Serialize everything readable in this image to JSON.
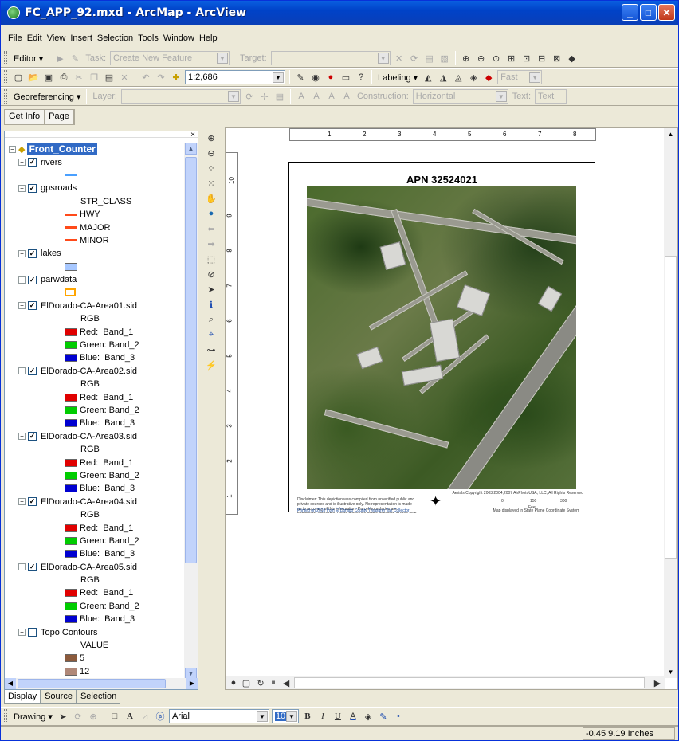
{
  "window": {
    "title": "FC_APP_92.mxd - ArcMap - ArcView"
  },
  "menu": [
    "File",
    "Edit",
    "View",
    "Insert",
    "Selection",
    "Tools",
    "Window",
    "Help"
  ],
  "editor_toolbar": {
    "editor": "Editor ▾",
    "task_label": "Task:",
    "task_value": "Create New Feature",
    "target_label": "Target:"
  },
  "standard_toolbar": {
    "scale": "1:2,686",
    "labeling": "Labeling ▾",
    "fast": "Fast"
  },
  "georef_toolbar": {
    "georeferencing": "Georeferencing ▾",
    "layer_label": "Layer:",
    "construction_label": "Construction:",
    "construction_value": "Horizontal",
    "text_label": "Text:",
    "text_value": "Text"
  },
  "getinfo_toolbar": {
    "get_info": "Get Info",
    "page": "Page"
  },
  "toc": {
    "frame": "Front_Counter",
    "rows": [
      {
        "kind": "layer",
        "text": "rivers",
        "checked": true
      },
      {
        "kind": "sym",
        "text": "",
        "color": "#4aa0ff",
        "shape": "line"
      },
      {
        "kind": "layer",
        "text": "gpsroads",
        "checked": true
      },
      {
        "kind": "head",
        "text": "STR_CLASS"
      },
      {
        "kind": "sym",
        "text": "HWY",
        "color": "#ff4a1a",
        "shape": "line"
      },
      {
        "kind": "sym",
        "text": "MAJOR",
        "color": "#ff4a1a",
        "shape": "line"
      },
      {
        "kind": "sym",
        "text": "MINOR",
        "color": "#ff4a1a",
        "shape": "line"
      },
      {
        "kind": "layer",
        "text": "lakes",
        "checked": true
      },
      {
        "kind": "sym",
        "text": "",
        "color": "#a8c8ff",
        "shape": "box"
      },
      {
        "kind": "layer",
        "text": "parwdata",
        "checked": true
      },
      {
        "kind": "sym",
        "text": "",
        "color": "#ffffff",
        "shape": "obox"
      },
      {
        "kind": "layer",
        "text": "ElDorado-CA-Area01.sid",
        "checked": true
      },
      {
        "kind": "head",
        "text": "RGB"
      },
      {
        "kind": "sym",
        "text": "Red:  Band_1",
        "color": "#e00000",
        "shape": "box"
      },
      {
        "kind": "sym",
        "text": "Green: Band_2",
        "color": "#00cc00",
        "shape": "box"
      },
      {
        "kind": "sym",
        "text": "Blue:  Band_3",
        "color": "#0000d0",
        "shape": "box"
      },
      {
        "kind": "layer",
        "text": "ElDorado-CA-Area02.sid",
        "checked": true
      },
      {
        "kind": "head",
        "text": "RGB"
      },
      {
        "kind": "sym",
        "text": "Red:  Band_1",
        "color": "#e00000",
        "shape": "box"
      },
      {
        "kind": "sym",
        "text": "Green: Band_2",
        "color": "#00cc00",
        "shape": "box"
      },
      {
        "kind": "sym",
        "text": "Blue:  Band_3",
        "color": "#0000d0",
        "shape": "box"
      },
      {
        "kind": "layer",
        "text": "ElDorado-CA-Area03.sid",
        "checked": true
      },
      {
        "kind": "head",
        "text": "RGB"
      },
      {
        "kind": "sym",
        "text": "Red:  Band_1",
        "color": "#e00000",
        "shape": "box"
      },
      {
        "kind": "sym",
        "text": "Green: Band_2",
        "color": "#00cc00",
        "shape": "box"
      },
      {
        "kind": "sym",
        "text": "Blue:  Band_3",
        "color": "#0000d0",
        "shape": "box"
      },
      {
        "kind": "layer",
        "text": "ElDorado-CA-Area04.sid",
        "checked": true
      },
      {
        "kind": "head",
        "text": "RGB"
      },
      {
        "kind": "sym",
        "text": "Red:  Band_1",
        "color": "#e00000",
        "shape": "box"
      },
      {
        "kind": "sym",
        "text": "Green: Band_2",
        "color": "#00cc00",
        "shape": "box"
      },
      {
        "kind": "sym",
        "text": "Blue:  Band_3",
        "color": "#0000d0",
        "shape": "box"
      },
      {
        "kind": "layer",
        "text": "ElDorado-CA-Area05.sid",
        "checked": true
      },
      {
        "kind": "head",
        "text": "RGB"
      },
      {
        "kind": "sym",
        "text": "Red:  Band_1",
        "color": "#e00000",
        "shape": "box"
      },
      {
        "kind": "sym",
        "text": "Green: Band_2",
        "color": "#00cc00",
        "shape": "box"
      },
      {
        "kind": "sym",
        "text": "Blue:  Band_3",
        "color": "#0000d0",
        "shape": "box"
      },
      {
        "kind": "layer",
        "text": "Topo Contours",
        "checked": false
      },
      {
        "kind": "head",
        "text": "VALUE"
      },
      {
        "kind": "sym",
        "text": "5",
        "color": "#8b5a3c",
        "shape": "box"
      },
      {
        "kind": "sym",
        "text": "12",
        "color": "#b08878",
        "shape": "box"
      }
    ]
  },
  "toc_tabs": [
    "Display",
    "Source",
    "Selection"
  ],
  "layout": {
    "title": "APN 32524021",
    "ruler_h": [
      "1",
      "2",
      "3",
      "4",
      "5",
      "6",
      "7",
      "8"
    ],
    "ruler_v": [
      "10",
      "9",
      "8",
      "7",
      "6",
      "5",
      "4",
      "3",
      "2",
      "1"
    ],
    "copyright": "Aerials Copyright 2003,2004,2007 AirPhotoUSA, LLC, All Rights Reserved",
    "disclaimer": "Disclaimer: This depiction was compiled from unverified public and private sources and is illustrative only. No representation is made as to accuracy of this information. Parcel boundaries are particularly unreliable. Users make use of this depiction at their own risk.",
    "printed": "Printed on 2010 from El Dorado County Treasurer Tax Collector Office",
    "scale_ticks": [
      "0",
      "150",
      "300"
    ],
    "scale_unit": "Feet",
    "projection": "Map displayed in State Plane Coordinate System (NAD 1983 California Zone 2, feet)"
  },
  "drawing_toolbar": {
    "drawing": "Drawing ▾",
    "font": "Arial",
    "size": "10",
    "bold": "B",
    "italic": "I",
    "underline": "U"
  },
  "status": {
    "coords": "-0.45  9.19 Inches"
  }
}
